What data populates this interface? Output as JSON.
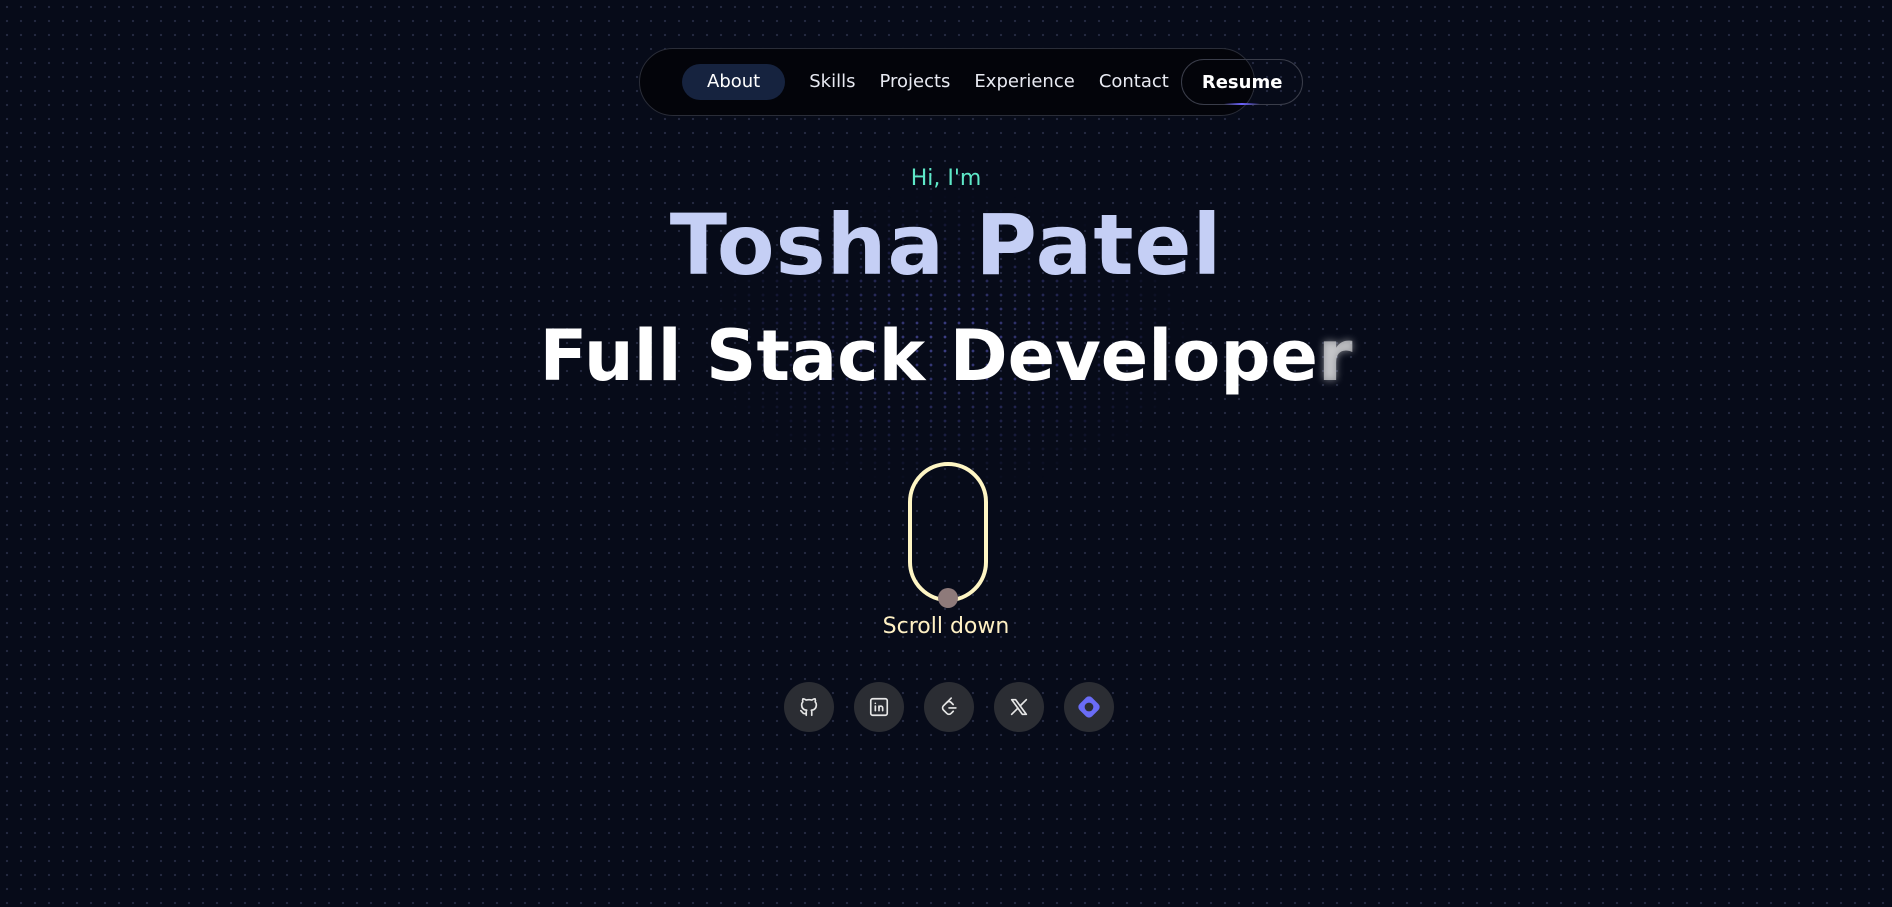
{
  "nav": {
    "items": [
      {
        "label": "About",
        "active": true
      },
      {
        "label": "Skills",
        "active": false
      },
      {
        "label": "Projects",
        "active": false
      },
      {
        "label": "Experience",
        "active": false
      },
      {
        "label": "Contact",
        "active": false
      }
    ],
    "resume_label": "Resume"
  },
  "hero": {
    "greeting": "Hi, I'm",
    "name": "Tosha Patel",
    "role_main": "Full Stack Develope",
    "role_tail": "r"
  },
  "scroll": {
    "label": "Scroll down"
  },
  "socials": [
    {
      "icon": "github-icon"
    },
    {
      "icon": "linkedin-icon"
    },
    {
      "icon": "leetcode-icon"
    },
    {
      "icon": "x-icon"
    },
    {
      "icon": "hashnode-icon"
    }
  ],
  "colors": {
    "background": "#070b19",
    "greeting": "#5ee8c8",
    "name": "#c5cff5",
    "scroll_accent": "#fff6c4",
    "nav_active": "#16233f",
    "hashnode": "#6a6cf6"
  }
}
